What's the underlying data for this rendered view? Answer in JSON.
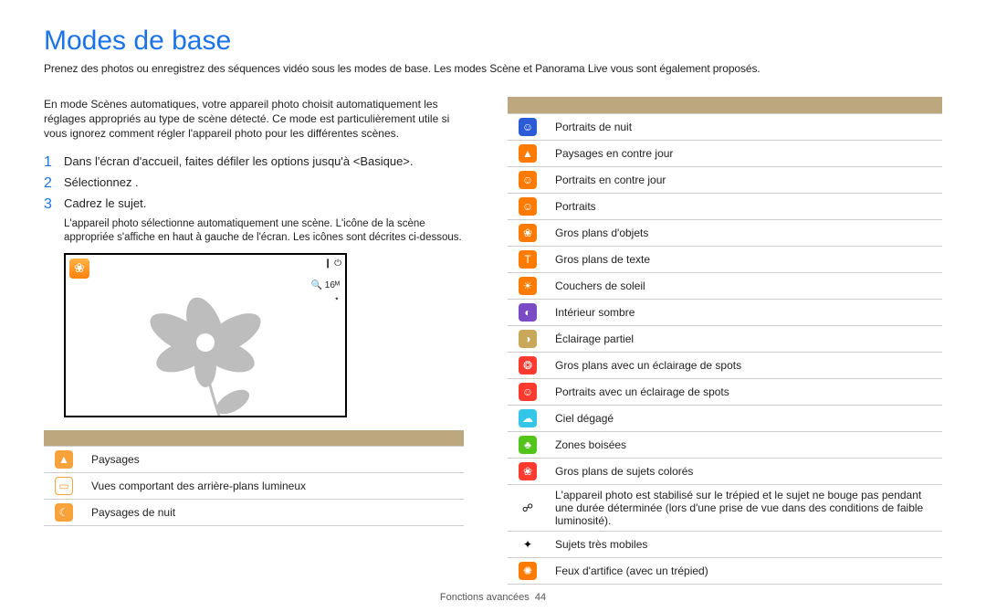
{
  "title": "Modes de base",
  "subtitle": "Prenez des photos ou enregistrez des séquences vidéo sous les modes de base. Les modes Scène et Panorama Live vous sont également proposés.",
  "intro": "En mode Scènes automatiques, votre appareil photo choisit automatiquement les réglages appropriés au type de scène détecté. Ce mode est particulièrement utile si vous ignorez comment régler l'appareil photo pour les différentes scènes.",
  "steps": {
    "s1": "Dans l'écran d'accueil, faites défiler les options jusqu'à <Basique>.",
    "s2": "Sélectionnez .",
    "s3": "Cadrez le sujet.",
    "s3_note": "L'appareil photo sélectionne automatiquement une scène. L'icône de la scène appropriée s'affiche en haut à gauche de l'écran. Les icônes sont décrites ci-dessous."
  },
  "preview": {
    "corner_glyph": "❀",
    "battery": "❙  ⏻",
    "zoom": "🔍 16ᴹ",
    "star": "⋆"
  },
  "left_rows": [
    {
      "glyph": "▲",
      "bg": "#f7a23b",
      "label": "Paysages"
    },
    {
      "glyph": "▭",
      "bg": "#ffffff",
      "fg": "#f7a23b",
      "border": "#f7a23b",
      "label": "Vues comportant des arrière-plans lumineux"
    },
    {
      "glyph": "☾",
      "bg": "#f7a23b",
      "label": "Paysages de nuit"
    }
  ],
  "right_rows": [
    {
      "glyph": "☺",
      "bg": "#2b5bd7",
      "label": "Portraits de nuit"
    },
    {
      "glyph": "▲",
      "bg": "#ff7a00",
      "label": "Paysages en contre jour"
    },
    {
      "glyph": "☺",
      "bg": "#ff7a00",
      "label": "Portraits en contre jour"
    },
    {
      "glyph": "☺",
      "bg": "#ff7a00",
      "label": "Portraits"
    },
    {
      "glyph": "❀",
      "bg": "#ff7a00",
      "label": "Gros plans d'objets"
    },
    {
      "glyph": "T",
      "bg": "#ff7a00",
      "label": "Gros plans de texte"
    },
    {
      "glyph": "☀",
      "bg": "#ff7a00",
      "label": "Couchers de soleil"
    },
    {
      "glyph": "◐",
      "bg": "#7a4bc4",
      "label": "Intérieur sombre"
    },
    {
      "glyph": "◑",
      "bg": "#c9a85a",
      "label": "Éclairage partiel"
    },
    {
      "glyph": "❂",
      "bg": "#ff3b30",
      "label": "Gros plans avec un éclairage de spots"
    },
    {
      "glyph": "☺",
      "bg": "#ff3b30",
      "label": "Portraits avec un éclairage de spots"
    },
    {
      "glyph": "☁",
      "bg": "#33c6e8",
      "label": "Ciel dégagé"
    },
    {
      "glyph": "♣",
      "bg": "#52c41a",
      "label": "Zones boisées"
    },
    {
      "glyph": "❀",
      "bg": "#ff3b30",
      "label": "Gros plans de sujets colorés"
    },
    {
      "glyph": "☍",
      "bg": "transparent",
      "fg": "#000",
      "label": "L'appareil photo est stabilisé sur le trépied et le sujet ne bouge pas pendant une durée déterminée (lors d'une prise de vue dans des conditions de faible luminosité)."
    },
    {
      "glyph": "✦",
      "bg": "transparent",
      "fg": "#000",
      "label": "Sujets très mobiles"
    },
    {
      "glyph": "✺",
      "bg": "#ff7a00",
      "label": "Feux d'artifice (avec un trépied)"
    }
  ],
  "footer": {
    "text": "Fonctions avancées",
    "page": "44"
  }
}
